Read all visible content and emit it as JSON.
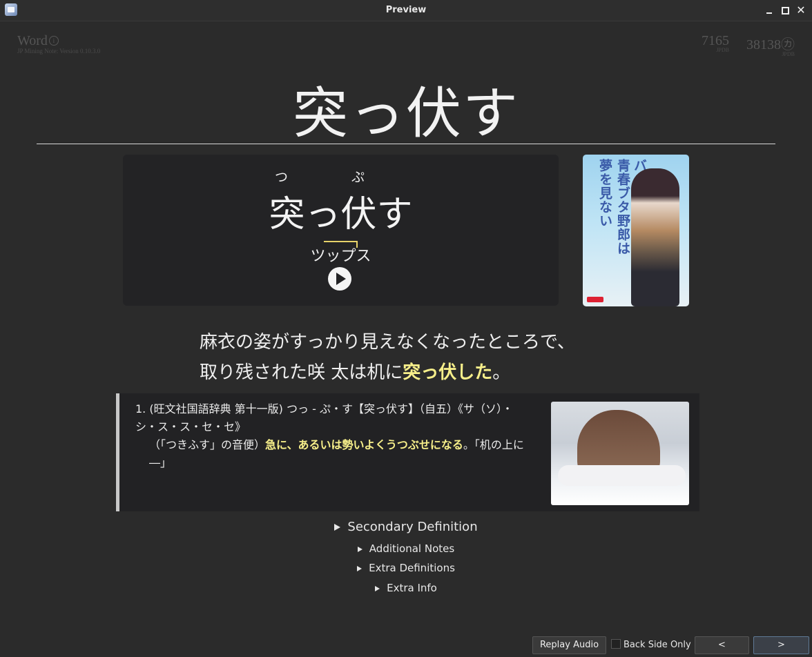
{
  "window": {
    "title": "Preview"
  },
  "header": {
    "note_type": "Word",
    "version": "JP Mining Note: Version 0.10.3.0",
    "freq": [
      {
        "value": "7165",
        "source": "JPDB"
      },
      {
        "value": "38138㋕",
        "source": "JPDB"
      }
    ]
  },
  "word": "突っ伏す",
  "reading": {
    "ruby_1": "つ",
    "ruby_2": "ぷ",
    "pitch": "ツップス",
    "play_icon": "play-icon"
  },
  "cover": {
    "text_1": "青春ブタ野郎は",
    "text_2": "バニーガール先輩の",
    "text_3": "夢を見ない"
  },
  "sentence": {
    "line1": "麻衣の姿がすっかり見えなくなったところで、",
    "line2_pre": "取り残された咲 太は机に",
    "line2_hl": "突っ伏した",
    "line2_post": "。"
  },
  "definition": {
    "line1": "1. (旺文社国語辞典 第十一版) つっ - ぷ・す【突っ伏す】（自五）《サ（ソ）・シ・ス・ス・セ・セ》",
    "line2_pre": "（「つきふす」の音便）",
    "line2_hl": "急に、あるいは勢いよくうつぶせになる",
    "line2_post": "。「机の上に―」"
  },
  "collapsibles": {
    "secondary": "Secondary Definition",
    "notes": "Additional Notes",
    "extra_defs": "Extra Definitions",
    "extra_info": "Extra Info"
  },
  "bottom": {
    "replay": "Replay Audio",
    "back_only": "Back Side Only",
    "prev": "<",
    "next": ">"
  }
}
